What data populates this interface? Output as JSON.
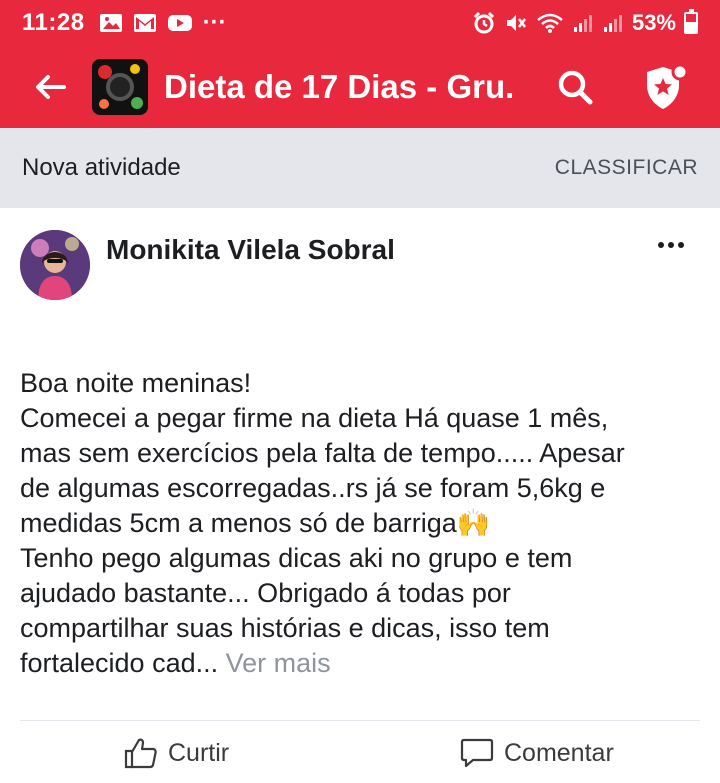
{
  "status_bar": {
    "time": "11:28",
    "more": "···",
    "battery_percent": "53%",
    "left_icons": [
      "gallery-icon",
      "gmail-icon",
      "youtube-icon"
    ],
    "right_icons": [
      "alarm-icon",
      "mute-icon",
      "wifi-icon",
      "signal-icon",
      "signal-icon",
      "battery-icon"
    ]
  },
  "app_bar": {
    "title": "Dieta de 17 Dias - Gru...",
    "background": "#e8293d"
  },
  "sort_bar": {
    "title": "Nova atividade",
    "sort_label": "CLASSIFICAR"
  },
  "post": {
    "author": "Monikita Vilela Sobral",
    "lines": [
      "Boa noite meninas!",
      "Comecei a pegar firme na dieta Há quase 1 mês,",
      "mas sem exercícios pela falta de tempo..... Apesar",
      "de algumas escorregadas..rs já se foram 5,6kg e",
      "medidas 5cm a menos só de barriga🙌",
      "Tenho pego algumas dicas aki no grupo e tem",
      "ajudado bastante... Obrigado á todas por",
      "compartilhar suas histórias e dicas, isso tem",
      "fortalecido cad..."
    ],
    "see_more": "Ver mais",
    "actions": {
      "like": "Curtir",
      "comment": "Comentar"
    }
  }
}
